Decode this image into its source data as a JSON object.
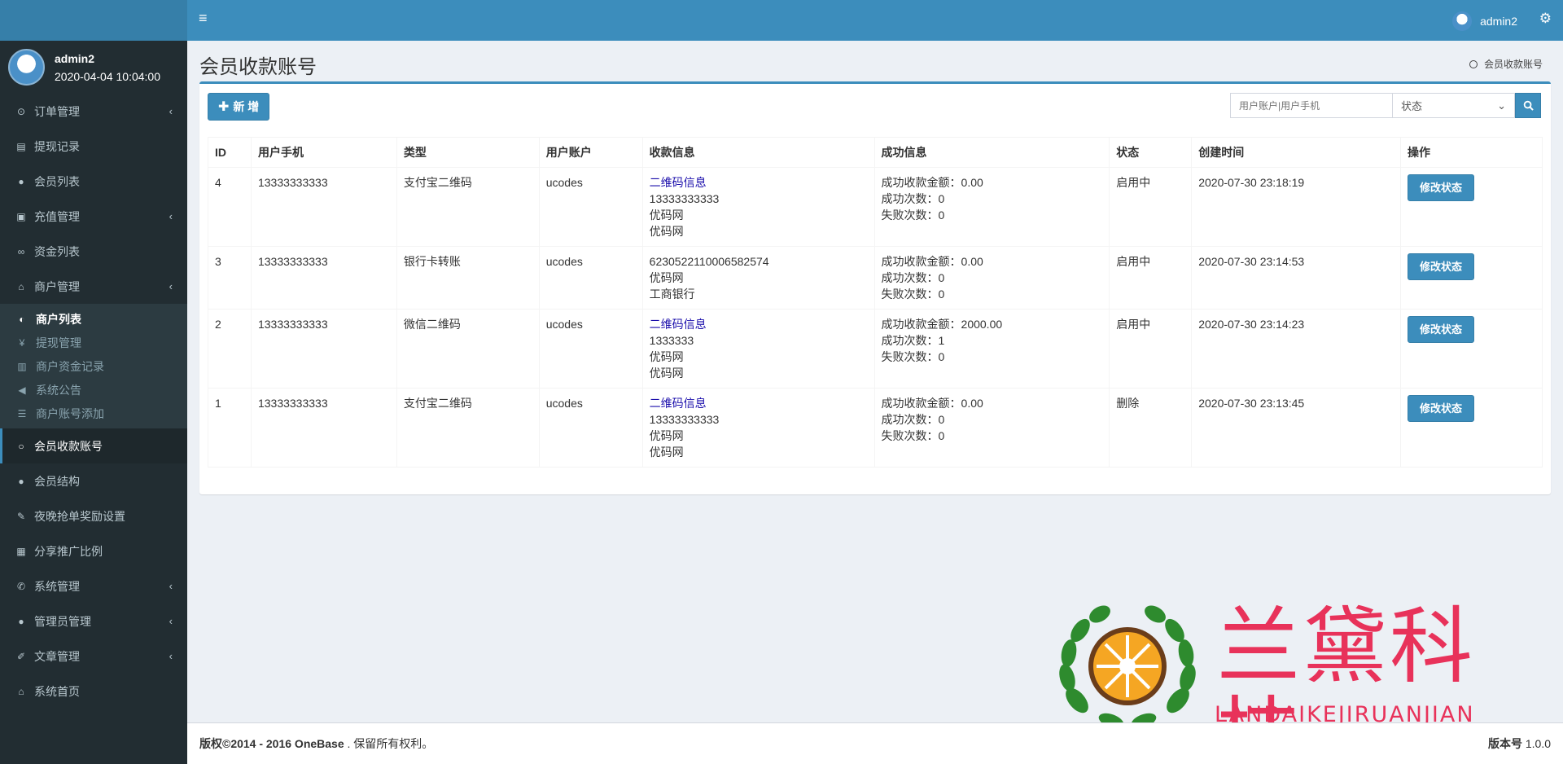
{
  "user": {
    "name": "admin2",
    "time": "2020-04-04 10:04:00"
  },
  "sidebar": {
    "items": [
      {
        "label": "订单管理",
        "icon": "circle-dot-icon",
        "arrow": true
      },
      {
        "label": "提现记录",
        "icon": "list-icon",
        "arrow": false
      },
      {
        "label": "会员列表",
        "icon": "user-icon",
        "arrow": false
      },
      {
        "label": "充值管理",
        "icon": "image-icon",
        "arrow": true
      },
      {
        "label": "资金列表",
        "icon": "link-icon",
        "arrow": false
      },
      {
        "label": "商户管理",
        "icon": "bank-icon",
        "arrow": true
      }
    ],
    "submenu": [
      {
        "label": "商户列表",
        "icon": "half-circle-icon"
      },
      {
        "label": "提现管理",
        "icon": "yen-icon"
      },
      {
        "label": "商户资金记录",
        "icon": "bar-chart-icon"
      },
      {
        "label": "系统公告",
        "icon": "bullhorn-icon"
      },
      {
        "label": "商户账号添加",
        "icon": "indent-icon"
      }
    ],
    "items2": [
      {
        "label": "会员收款账号",
        "icon": "circle-icon",
        "arrow": false
      },
      {
        "label": "会员结构",
        "icon": "users-icon",
        "arrow": false
      },
      {
        "label": "夜晚抢单奖励设置",
        "icon": "gavel-icon",
        "arrow": false
      },
      {
        "label": "分享推广比例",
        "icon": "linkedin-icon",
        "arrow": false
      },
      {
        "label": "系统管理",
        "icon": "wrench-icon",
        "arrow": true
      },
      {
        "label": "管理员管理",
        "icon": "users-icon",
        "arrow": true
      },
      {
        "label": "文章管理",
        "icon": "edit-icon",
        "arrow": true
      },
      {
        "label": "系统首页",
        "icon": "home-icon",
        "arrow": false
      }
    ]
  },
  "header": {
    "menu_glyph": "≡",
    "user": "admin2",
    "gear_glyph": "⚙"
  },
  "page": {
    "title": "会员收款账号",
    "breadcrumb": "会员收款账号"
  },
  "toolbar": {
    "add_label": "新 增",
    "search_placeholder": "用户账户|用户手机",
    "status_select": "状态"
  },
  "table": {
    "headers": [
      "ID",
      "用户手机",
      "类型",
      "用户账户",
      "收款信息",
      "成功信息",
      "状态",
      "创建时间",
      "操作"
    ],
    "rows": [
      {
        "id": "4",
        "phone": "13333333333",
        "type": "支付宝二维码",
        "account": "ucodes",
        "pay_link": "二维码信息",
        "pay_lines": [
          "13333333333",
          "优码网",
          "优码网"
        ],
        "success": [
          "成功收款金额：0.00",
          "成功次数：0",
          "失败次数：0"
        ],
        "status": "启用中",
        "created": "2020-07-30 23:18:19",
        "action": "修改状态"
      },
      {
        "id": "3",
        "phone": "13333333333",
        "type": "银行卡转账",
        "account": "ucodes",
        "pay_link": "",
        "pay_lines": [
          "6230522110006582574",
          "优码网",
          "工商银行"
        ],
        "success": [
          "成功收款金额：0.00",
          "成功次数：0",
          "失败次数：0"
        ],
        "status": "启用中",
        "created": "2020-07-30 23:14:53",
        "action": "修改状态"
      },
      {
        "id": "2",
        "phone": "13333333333",
        "type": "微信二维码",
        "account": "ucodes",
        "pay_link": "二维码信息",
        "pay_lines": [
          "1333333",
          "优码网",
          "优码网"
        ],
        "success": [
          "成功收款金额：2000.00",
          "成功次数：1",
          "失败次数：0"
        ],
        "status": "启用中",
        "created": "2020-07-30 23:14:23",
        "action": "修改状态"
      },
      {
        "id": "1",
        "phone": "13333333333",
        "type": "支付宝二维码",
        "account": "ucodes",
        "pay_link": "二维码信息",
        "pay_lines": [
          "13333333333",
          "优码网",
          "优码网"
        ],
        "success": [
          "成功收款金额：0.00",
          "成功次数：0",
          "失败次数：0"
        ],
        "status": "删除",
        "created": "2020-07-30 23:13:45",
        "action": "修改状态"
      }
    ]
  },
  "footer": {
    "copyright_bold": "版权©2014 - 2016 OneBase",
    "copyright_rest": " . 保留所有权利。",
    "version_label": "版本号",
    "version": "1.0.0"
  },
  "watermark": {
    "text": "兰黛科技",
    "sub": "LANDAIKEJIRUANJIAN"
  },
  "colors": {
    "primary": "#3c8dbc",
    "sidebar": "#222d32",
    "watermark": "#e8325a"
  }
}
